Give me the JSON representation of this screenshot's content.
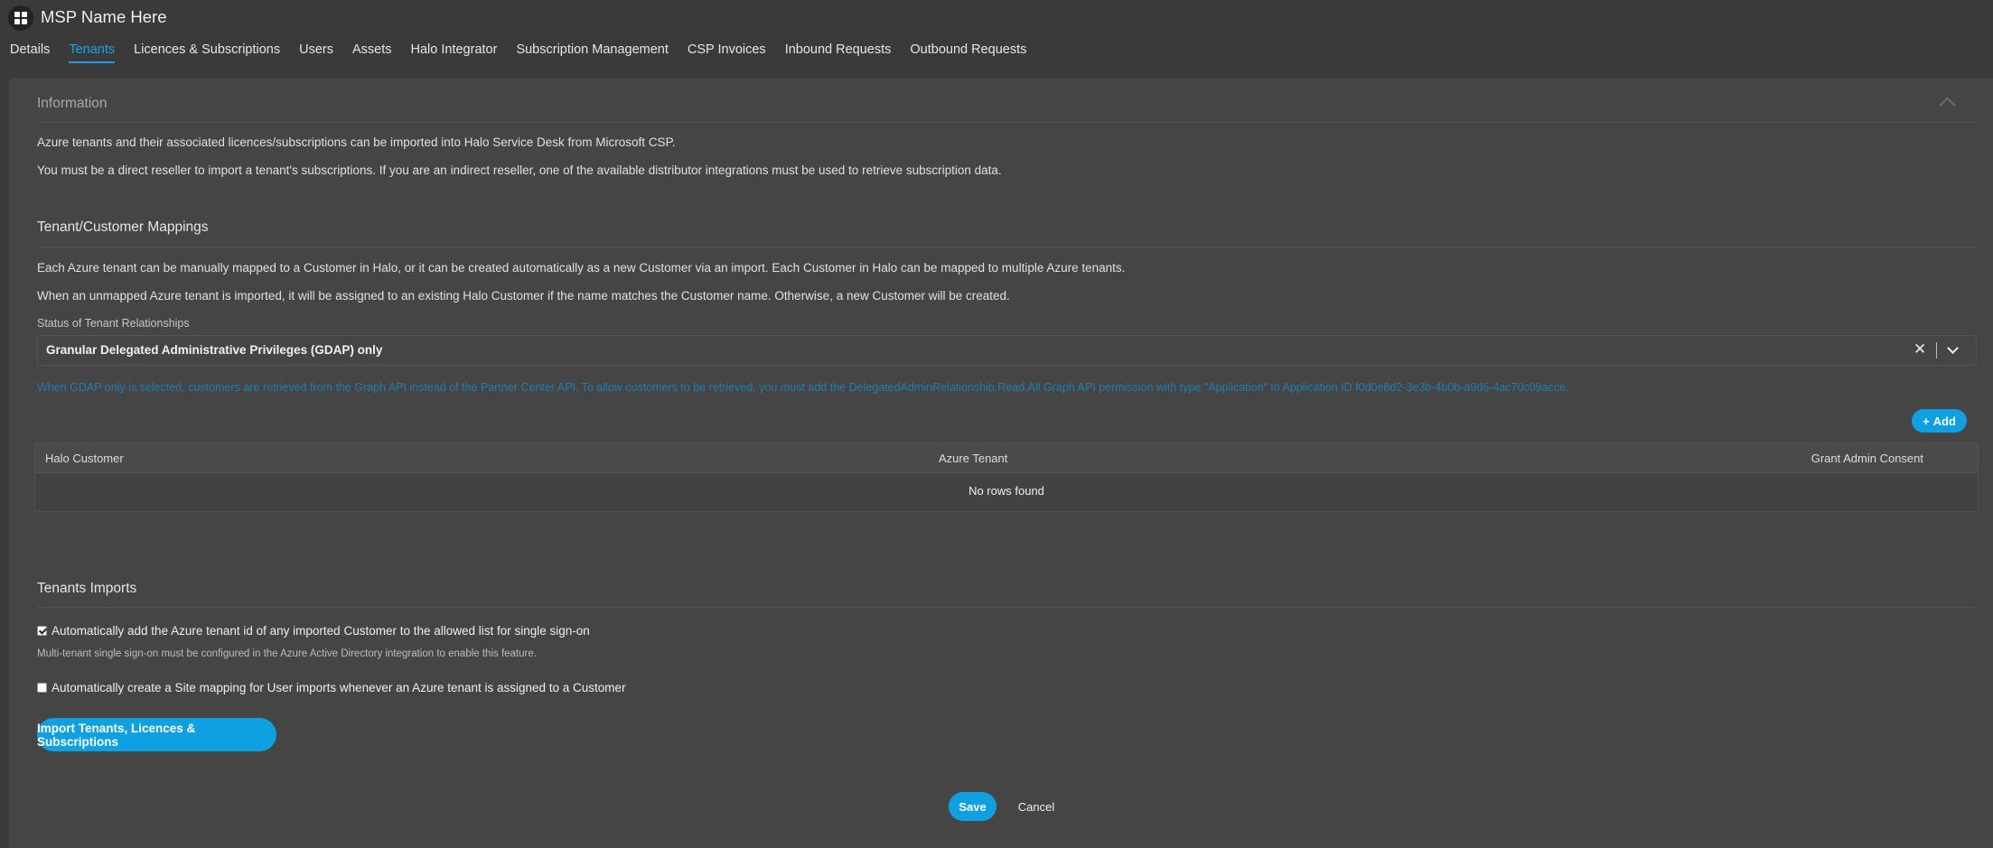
{
  "app": {
    "title": "MSP Name Here",
    "icon": "windows-grid-icon"
  },
  "tabs": [
    {
      "label": "Details"
    },
    {
      "label": "Tenants",
      "active": true
    },
    {
      "label": "Licences & Subscriptions"
    },
    {
      "label": "Users"
    },
    {
      "label": "Assets"
    },
    {
      "label": "Halo Integrator"
    },
    {
      "label": "Subscription Management"
    },
    {
      "label": "CSP Invoices"
    },
    {
      "label": "Inbound Requests"
    },
    {
      "label": "Outbound Requests"
    }
  ],
  "information": {
    "title": "Information",
    "p1": "Azure tenants and their associated licences/subscriptions can be imported into Halo Service Desk from Microsoft CSP.",
    "p2": "You must be a direct reseller to import a tenant's subscriptions. If you are an indirect reseller, one of the available distributor integrations must be used to retrieve subscription data."
  },
  "mappings": {
    "title": "Tenant/Customer Mappings",
    "p1": "Each Azure tenant can be manually mapped to a Customer in Halo, or it can be created automatically as a new Customer via an import. Each Customer in Halo can be mapped to multiple Azure tenants.",
    "p2": "When an unmapped Azure tenant is imported, it will be assigned to an existing Halo Customer if the name matches the Customer name. Otherwise, a new Customer will be created.",
    "status_label": "Status of Tenant Relationships",
    "status_value": "Granular Delegated Administrative Privileges (GDAP) only",
    "note": "When GDAP only is selected, customers are retrieved from the Graph API instead of the Partner Center API. To allow customers to be retrieved, you must add the DelegatedAdminRelationship.Read.All Graph API permission with type \"Application\" to Application ID f0d0e8d2-3e3b-4b0b-a9d6-4ac70c09acce.",
    "add_label": "Add",
    "table": {
      "columns": [
        "Halo Customer",
        "Azure Tenant",
        "Grant Admin Consent"
      ],
      "empty": "No rows found"
    }
  },
  "imports": {
    "title": "Tenants Imports",
    "chk1_label": "Automatically add the Azure tenant id of any imported Customer to the allowed list for single sign-on",
    "chk1_checked": true,
    "chk1_sub": "Multi-tenant single sign-on must be configured in the Azure Active Directory integration to enable this feature.",
    "chk2_label": "Automatically create a Site mapping for User imports whenever an Azure tenant is assigned to a Customer",
    "chk2_checked": false,
    "import_button": "Import Tenants, Licences & Subscriptions"
  },
  "footer": {
    "save": "Save",
    "cancel": "Cancel"
  },
  "colors": {
    "accent": "#0ea0e0",
    "note": "#1d7fb4",
    "background": "#3a3a3a",
    "panel": "#454545"
  }
}
